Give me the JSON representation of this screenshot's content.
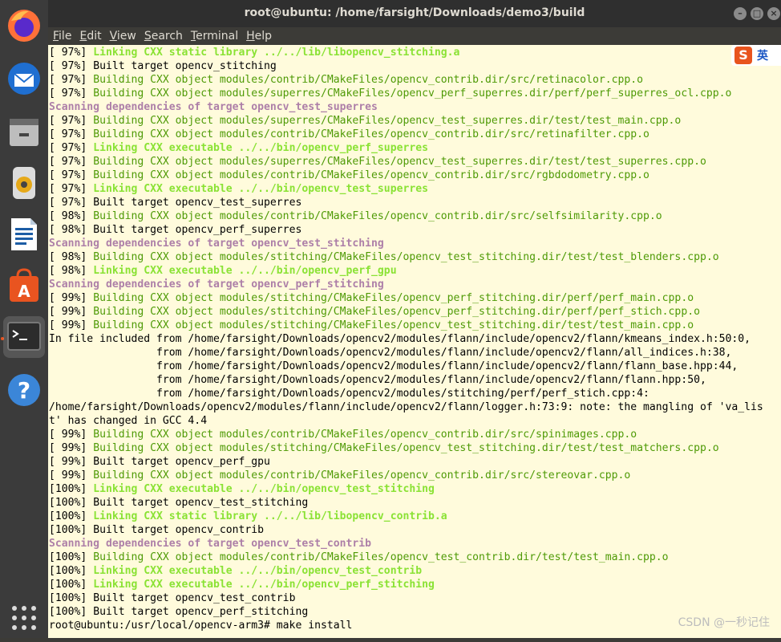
{
  "window": {
    "title": "root@ubuntu: /home/farsight/Downloads/demo3/build"
  },
  "menu": [
    {
      "mn": "F",
      "rest": "ile"
    },
    {
      "mn": "E",
      "rest": "dit"
    },
    {
      "mn": "V",
      "rest": "iew"
    },
    {
      "mn": "S",
      "rest": "earch"
    },
    {
      "mn": "T",
      "rest": "erminal"
    },
    {
      "mn": "H",
      "rest": "elp"
    }
  ],
  "dock": [
    {
      "name": "firefox-icon",
      "active": false
    },
    {
      "name": "thunderbird-icon",
      "active": false
    },
    {
      "name": "files-icon",
      "active": false
    },
    {
      "name": "rhythmbox-icon",
      "active": false
    },
    {
      "name": "libreoffice-writer-icon",
      "active": false
    },
    {
      "name": "software-center-icon",
      "active": false
    },
    {
      "name": "terminal-icon",
      "active": true
    },
    {
      "name": "help-icon",
      "active": false
    },
    {
      "name": "show-apps-icon",
      "active": false
    }
  ],
  "ime": {
    "logo": "S",
    "text": "英"
  },
  "watermark": "CSDN @一秒记住",
  "colors": {
    "terminal_bg": "#fffbdc",
    "green": "#4e9a06",
    "bright_green": "#8ae234",
    "magenta": "#ad7fa8",
    "accent": "#e95420"
  },
  "terminal_lines": [
    {
      "p": "[ 97%] ",
      "t": "Linking CXX static library ../../lib/libopencv_stitching.a",
      "c": "bgreen"
    },
    {
      "p": "[ 97%] ",
      "t": "Built target opencv_stitching",
      "c": "default"
    },
    {
      "p": "[ 97%] ",
      "t": "Building CXX object modules/contrib/CMakeFiles/opencv_contrib.dir/src/retinacolor.cpp.o",
      "c": "green"
    },
    {
      "p": "[ 97%] ",
      "t": "Building CXX object modules/superres/CMakeFiles/opencv_perf_superres.dir/perf/perf_superres_ocl.cpp.o",
      "c": "green"
    },
    {
      "p": "",
      "t": "Scanning dependencies of target opencv_test_superres",
      "c": "magenta"
    },
    {
      "p": "[ 97%] ",
      "t": "Building CXX object modules/superres/CMakeFiles/opencv_test_superres.dir/test/test_main.cpp.o",
      "c": "green"
    },
    {
      "p": "[ 97%] ",
      "t": "Building CXX object modules/contrib/CMakeFiles/opencv_contrib.dir/src/retinafilter.cpp.o",
      "c": "green"
    },
    {
      "p": "[ 97%] ",
      "t": "Linking CXX executable ../../bin/opencv_perf_superres",
      "c": "bgreen"
    },
    {
      "p": "[ 97%] ",
      "t": "Building CXX object modules/superres/CMakeFiles/opencv_test_superres.dir/test/test_superres.cpp.o",
      "c": "green"
    },
    {
      "p": "[ 97%] ",
      "t": "Building CXX object modules/contrib/CMakeFiles/opencv_contrib.dir/src/rgbdodometry.cpp.o",
      "c": "green"
    },
    {
      "p": "[ 97%] ",
      "t": "Linking CXX executable ../../bin/opencv_test_superres",
      "c": "bgreen"
    },
    {
      "p": "[ 97%] ",
      "t": "Built target opencv_test_superres",
      "c": "default"
    },
    {
      "p": "[ 98%] ",
      "t": "Building CXX object modules/contrib/CMakeFiles/opencv_contrib.dir/src/selfsimilarity.cpp.o",
      "c": "green"
    },
    {
      "p": "[ 98%] ",
      "t": "Built target opencv_perf_superres",
      "c": "default"
    },
    {
      "p": "",
      "t": "Scanning dependencies of target opencv_test_stitching",
      "c": "magenta"
    },
    {
      "p": "[ 98%] ",
      "t": "Building CXX object modules/stitching/CMakeFiles/opencv_test_stitching.dir/test/test_blenders.cpp.o",
      "c": "green"
    },
    {
      "p": "[ 98%] ",
      "t": "Linking CXX executable ../../bin/opencv_perf_gpu",
      "c": "bgreen"
    },
    {
      "p": "",
      "t": "Scanning dependencies of target opencv_perf_stitching",
      "c": "magenta"
    },
    {
      "p": "[ 99%] ",
      "t": "Building CXX object modules/stitching/CMakeFiles/opencv_perf_stitching.dir/perf/perf_main.cpp.o",
      "c": "green"
    },
    {
      "p": "[ 99%] ",
      "t": "Building CXX object modules/stitching/CMakeFiles/opencv_perf_stitching.dir/perf/perf_stich.cpp.o",
      "c": "green"
    },
    {
      "p": "[ 99%] ",
      "t": "Building CXX object modules/stitching/CMakeFiles/opencv_test_stitching.dir/test/test_main.cpp.o",
      "c": "green"
    },
    {
      "p": "",
      "t": "In file included from /home/farsight/Downloads/opencv2/modules/flann/include/opencv2/flann/kmeans_index.h:50:0,",
      "c": "default"
    },
    {
      "p": "",
      "t": "                 from /home/farsight/Downloads/opencv2/modules/flann/include/opencv2/flann/all_indices.h:38,",
      "c": "default"
    },
    {
      "p": "",
      "t": "                 from /home/farsight/Downloads/opencv2/modules/flann/include/opencv2/flann/flann_base.hpp:44,",
      "c": "default"
    },
    {
      "p": "",
      "t": "                 from /home/farsight/Downloads/opencv2/modules/flann/include/opencv2/flann/flann.hpp:50,",
      "c": "default"
    },
    {
      "p": "",
      "t": "                 from /home/farsight/Downloads/opencv2/modules/stitching/perf/perf_stich.cpp:4:",
      "c": "default"
    },
    {
      "p": "",
      "t": "/home/farsight/Downloads/opencv2/modules/flann/include/opencv2/flann/logger.h:73:9: note: the mangling of 'va_lis",
      "c": "default"
    },
    {
      "p": "",
      "t": "t' has changed in GCC 4.4",
      "c": "default"
    },
    {
      "p": "[ 99%] ",
      "t": "Building CXX object modules/contrib/CMakeFiles/opencv_contrib.dir/src/spinimages.cpp.o",
      "c": "green"
    },
    {
      "p": "[ 99%] ",
      "t": "Building CXX object modules/stitching/CMakeFiles/opencv_test_stitching.dir/test/test_matchers.cpp.o",
      "c": "green"
    },
    {
      "p": "[ 99%] ",
      "t": "Built target opencv_perf_gpu",
      "c": "default"
    },
    {
      "p": "[ 99%] ",
      "t": "Building CXX object modules/contrib/CMakeFiles/opencv_contrib.dir/src/stereovar.cpp.o",
      "c": "green"
    },
    {
      "p": "[100%] ",
      "t": "Linking CXX executable ../../bin/opencv_test_stitching",
      "c": "bgreen"
    },
    {
      "p": "[100%] ",
      "t": "Built target opencv_test_stitching",
      "c": "default"
    },
    {
      "p": "[100%] ",
      "t": "Linking CXX static library ../../lib/libopencv_contrib.a",
      "c": "bgreen"
    },
    {
      "p": "[100%] ",
      "t": "Built target opencv_contrib",
      "c": "default"
    },
    {
      "p": "",
      "t": "Scanning dependencies of target opencv_test_contrib",
      "c": "magenta"
    },
    {
      "p": "[100%] ",
      "t": "Building CXX object modules/contrib/CMakeFiles/opencv_test_contrib.dir/test/test_main.cpp.o",
      "c": "green"
    },
    {
      "p": "[100%] ",
      "t": "Linking CXX executable ../../bin/opencv_test_contrib",
      "c": "bgreen"
    },
    {
      "p": "[100%] ",
      "t": "Linking CXX executable ../../bin/opencv_perf_stitching",
      "c": "bgreen"
    },
    {
      "p": "[100%] ",
      "t": "Built target opencv_test_contrib",
      "c": "default"
    },
    {
      "p": "[100%] ",
      "t": "Built target opencv_perf_stitching",
      "c": "default"
    },
    {
      "p": "",
      "t": "root@ubuntu:/usr/local/opencv-arm3# make install",
      "c": "default"
    }
  ]
}
